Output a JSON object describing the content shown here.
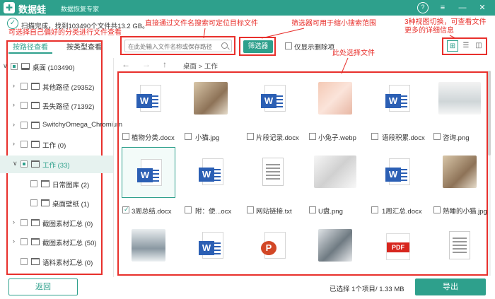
{
  "app": {
    "logo_char": "✚",
    "name": "数据蛙",
    "subtitle": "数据恢复专家"
  },
  "window": {
    "help_icon": "?",
    "menu_icon": "≡",
    "minimize_icon": "—",
    "close_icon": "✕"
  },
  "scan": {
    "status": "扫描完成，找到103490个文件共13.2 GB。",
    "check_icon": "✓"
  },
  "annotations": {
    "tip_preference": "可选择自己偏好的分类进行文件查看",
    "tip_search": "直接通过文件名搜索可定位目标文件",
    "tip_filter": "筛选器可用于缩小搜索范围",
    "tip_views_1": "3种视图切换，可查看文件",
    "tip_views_2": "更多的详细信息",
    "tip_select": "此处选择文件"
  },
  "tabs": {
    "by_path": "按路径查看",
    "by_type": "按类型查看"
  },
  "tree": [
    {
      "label": "桌面 (103490)",
      "arrow": "∨",
      "check": "part",
      "icon": "desktop"
    },
    {
      "label": "其他路径 (29352)",
      "arrow": "›",
      "check": "none",
      "icon": "folder"
    },
    {
      "label": "丢失路径 (71392)",
      "arrow": "›",
      "check": "none",
      "icon": "folder"
    },
    {
      "label": "SwitchyOmega_Chromium",
      "arrow": "›",
      "check": "none",
      "icon": "folder"
    },
    {
      "label": "工作 (0)",
      "arrow": "›",
      "check": "none",
      "icon": "folder"
    },
    {
      "label": "工作 (33)",
      "arrow": "∨",
      "check": "part",
      "icon": "folder"
    },
    {
      "label": "日常图库 (2)",
      "arrow": "",
      "check": "none",
      "icon": "folder"
    },
    {
      "label": "桌面壁纸 (1)",
      "arrow": "",
      "check": "none",
      "icon": "folder"
    },
    {
      "label": "截图素材汇总 (0)",
      "arrow": "›",
      "check": "none",
      "icon": "folder"
    },
    {
      "label": "截图素材汇总 (50)",
      "arrow": "›",
      "check": "none",
      "icon": "folder"
    },
    {
      "label": "语料素材汇总 (0)",
      "arrow": "",
      "check": "none",
      "icon": "folder"
    }
  ],
  "search": {
    "placeholder": "在此处输入文件名称或保存路径"
  },
  "filter": {
    "label": "筛选器"
  },
  "deleted_only": {
    "label": "仅显示删除项"
  },
  "views": {
    "thumbnail_icon": "⊞",
    "list_icon": "☰",
    "detail_icon": "◫"
  },
  "nav": {
    "back": "←",
    "forward": "→",
    "up": "↑"
  },
  "breadcrumb": "桌面 > 工作",
  "files": [
    {
      "name": "植物分类.docx",
      "type": "word"
    },
    {
      "name": "小猫.jpg",
      "type": "cat"
    },
    {
      "name": "片段记录.docx",
      "type": "word"
    },
    {
      "name": "小兔子.webp",
      "type": "rabbit"
    },
    {
      "name": "语段积累.docx",
      "type": "word"
    },
    {
      "name": "咨询.png",
      "type": "office"
    },
    {
      "name": "3周总结.docx",
      "type": "word",
      "checked": true
    },
    {
      "name": "附：使...ocx",
      "type": "word"
    },
    {
      "name": "网站链接.txt",
      "type": "txt"
    },
    {
      "name": "U盘.png",
      "type": "usb"
    },
    {
      "name": "1周汇总.docx",
      "type": "word"
    },
    {
      "name": "熟睡的小猫.jpg",
      "type": "cat"
    },
    {
      "name": "",
      "type": "laptop"
    },
    {
      "name": "",
      "type": "word"
    },
    {
      "name": "",
      "type": "ppt"
    },
    {
      "name": "",
      "type": "desk"
    },
    {
      "name": "",
      "type": "pdf"
    },
    {
      "name": "",
      "type": "txt"
    }
  ],
  "file_icons": {
    "word_letter": "W",
    "ppt_letter": "P",
    "pdf_label": "PDF"
  },
  "footer": {
    "back": "返回",
    "selection": "已选择 1个项目/ 1.33 MB",
    "export": "导出"
  }
}
